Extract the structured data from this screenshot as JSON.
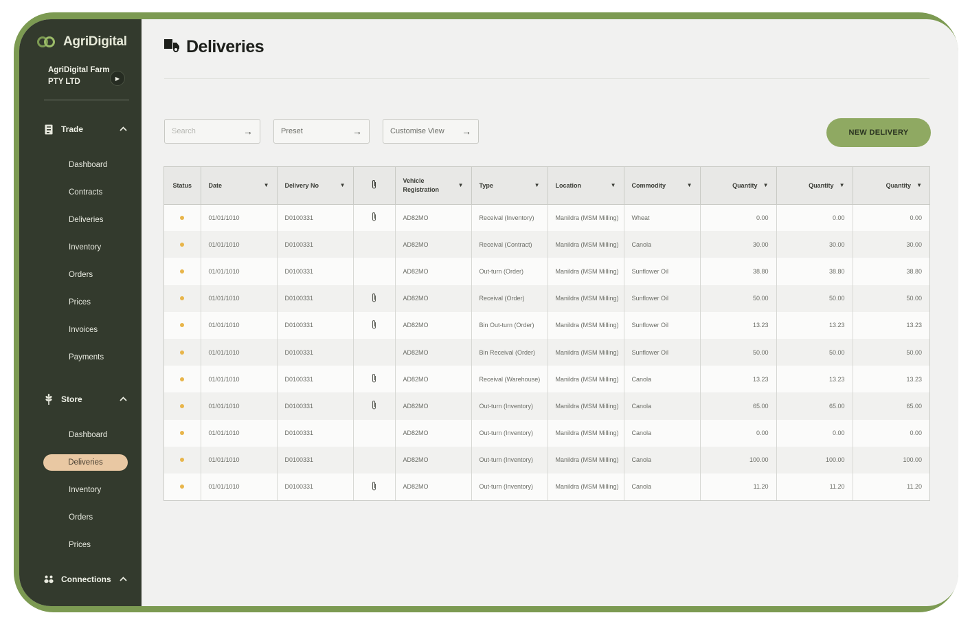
{
  "app": {
    "brand": "AgriDigital",
    "org_name": "AgriDigital Farm PTY LTD"
  },
  "sidebar": {
    "trade": {
      "label": "Trade",
      "items": [
        "Dashboard",
        "Contracts",
        "Deliveries",
        "Inventory",
        "Orders",
        "Prices",
        "Invoices",
        "Payments"
      ]
    },
    "store": {
      "label": "Store",
      "items": [
        "Dashboard",
        "Deliveries",
        "Inventory",
        "Orders",
        "Prices"
      ],
      "active": "Deliveries"
    },
    "connections": {
      "label": "Connections"
    }
  },
  "page": {
    "title": "Deliveries"
  },
  "toolbar": {
    "search_placeholder": "Search",
    "preset_label": "Preset",
    "customise_label": "Customise View",
    "new_delivery_label": "NEW DELIVERY"
  },
  "table": {
    "columns": [
      "Status",
      "Date",
      "Delivery No",
      "",
      "Vehicle Registration",
      "Type",
      "Location",
      "Commodity",
      "Quantity",
      "Quantity",
      "Quantity"
    ],
    "rows": [
      {
        "date": "01/01/1010",
        "delivery_no": "D0100331",
        "attachment": true,
        "vehicle": "AD82MO",
        "type": "Receival (Inventory)",
        "location": "Manildra (MSM Milling)",
        "commodity": "Wheat",
        "q1": "0.00",
        "q2": "0.00",
        "q3": "0.00"
      },
      {
        "date": "01/01/1010",
        "delivery_no": "D0100331",
        "attachment": false,
        "vehicle": "AD82MO",
        "type": "Receival (Contract)",
        "location": "Manildra (MSM Milling)",
        "commodity": "Canola",
        "q1": "30.00",
        "q2": "30.00",
        "q3": "30.00"
      },
      {
        "date": "01/01/1010",
        "delivery_no": "D0100331",
        "attachment": false,
        "vehicle": "AD82MO",
        "type": "Out-turn (Order)",
        "location": "Manildra (MSM Milling)",
        "commodity": "Sunflower Oil",
        "q1": "38.80",
        "q2": "38.80",
        "q3": "38.80"
      },
      {
        "date": "01/01/1010",
        "delivery_no": "D0100331",
        "attachment": true,
        "vehicle": "AD82MO",
        "type": "Receival (Order)",
        "location": "Manildra (MSM Milling)",
        "commodity": "Sunflower Oil",
        "q1": "50.00",
        "q2": "50.00",
        "q3": "50.00"
      },
      {
        "date": "01/01/1010",
        "delivery_no": "D0100331",
        "attachment": true,
        "vehicle": "AD82MO",
        "type": "Bin Out-turn (Order)",
        "location": "Manildra (MSM Milling)",
        "commodity": "Sunflower Oil",
        "q1": "13.23",
        "q2": "13.23",
        "q3": "13.23"
      },
      {
        "date": "01/01/1010",
        "delivery_no": "D0100331",
        "attachment": false,
        "vehicle": "AD82MO",
        "type": "Bin Receival (Order)",
        "location": "Manildra (MSM Milling)",
        "commodity": "Sunflower Oil",
        "q1": "50.00",
        "q2": "50.00",
        "q3": "50.00"
      },
      {
        "date": "01/01/1010",
        "delivery_no": "D0100331",
        "attachment": true,
        "vehicle": "AD82MO",
        "type": "Receival (Warehouse)",
        "location": "Manildra (MSM Milling)",
        "commodity": "Canola",
        "q1": "13.23",
        "q2": "13.23",
        "q3": "13.23"
      },
      {
        "date": "01/01/1010",
        "delivery_no": "D0100331",
        "attachment": true,
        "vehicle": "AD82MO",
        "type": "Out-turn (Inventory)",
        "location": "Manildra (MSM Milling)",
        "commodity": "Canola",
        "q1": "65.00",
        "q2": "65.00",
        "q3": "65.00"
      },
      {
        "date": "01/01/1010",
        "delivery_no": "D0100331",
        "attachment": false,
        "vehicle": "AD82MO",
        "type": "Out-turn (Inventory)",
        "location": "Manildra (MSM Milling)",
        "commodity": "Canola",
        "q1": "0.00",
        "q2": "0.00",
        "q3": "0.00"
      },
      {
        "date": "01/01/1010",
        "delivery_no": "D0100331",
        "attachment": false,
        "vehicle": "AD82MO",
        "type": "Out-turn (Inventory)",
        "location": "Manildra (MSM Milling)",
        "commodity": "Canola",
        "q1": "100.00",
        "q2": "100.00",
        "q3": "100.00"
      },
      {
        "date": "01/01/1010",
        "delivery_no": "D0100331",
        "attachment": true,
        "vehicle": "AD82MO",
        "type": "Out-turn (Inventory)",
        "location": "Manildra (MSM Milling)",
        "commodity": "Canola",
        "q1": "11.20",
        "q2": "11.20",
        "q3": "11.20"
      }
    ]
  },
  "colors": {
    "sidebar": "#333a2d",
    "accent": "#8fa962",
    "active_nav": "#e9c8a3",
    "status_dot": "#e8b54a"
  },
  "icons": {
    "trade": "document-icon",
    "store": "wheat-icon",
    "connections": "people-icon",
    "attachment": "paperclip-icon",
    "title": "truck-icon"
  }
}
